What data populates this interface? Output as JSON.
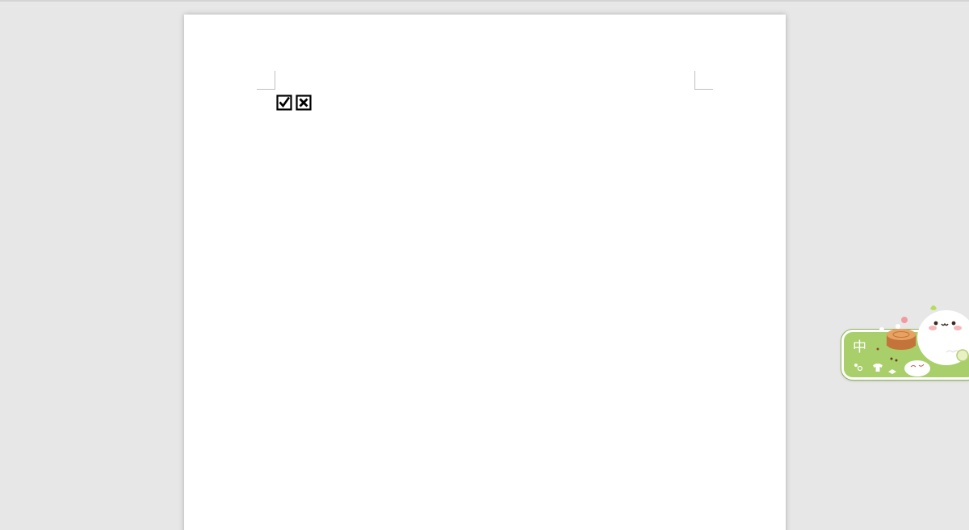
{
  "document": {
    "symbols": [
      {
        "name": "checked-box",
        "glyph": "☑"
      },
      {
        "name": "x-box",
        "glyph": "☒"
      }
    ]
  },
  "ime_toolbar": {
    "mode_label": "中",
    "icons": [
      "punctuation-icon",
      "skin-icon",
      "keyboard-icon",
      "mascot-icon"
    ],
    "colors": {
      "body": "#a8cf6a",
      "border": "#ffffff"
    }
  }
}
